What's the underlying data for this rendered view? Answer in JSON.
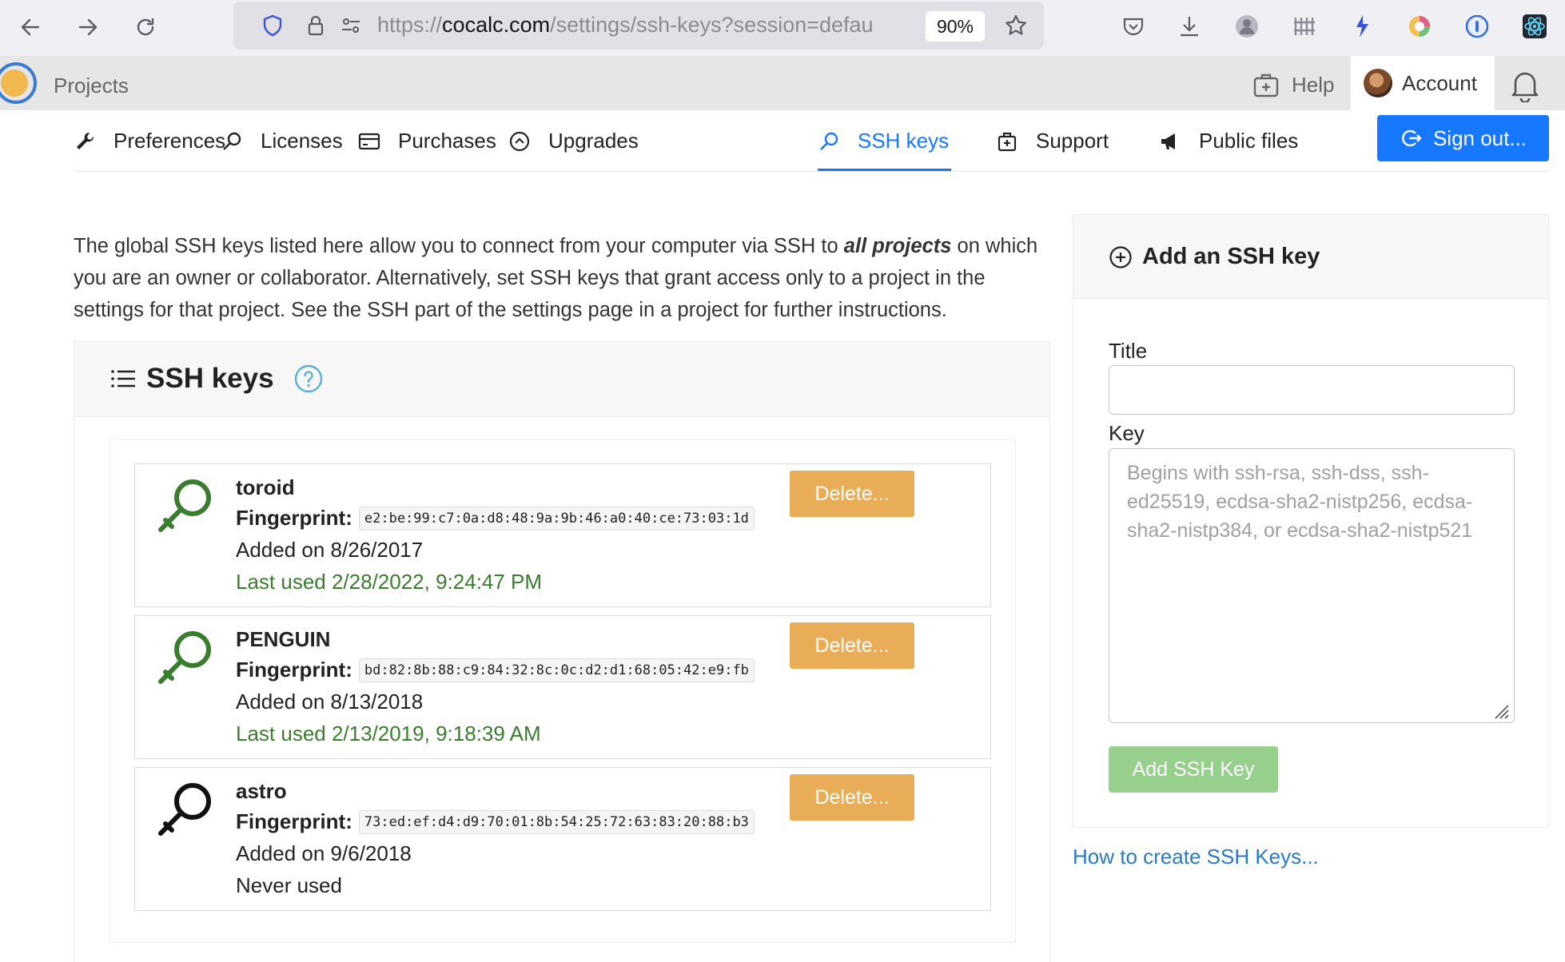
{
  "browser": {
    "url_prefix": "https://",
    "url_host": "cocalc.com",
    "url_path": "/settings/ssh-keys?session=defau",
    "zoom": "90%"
  },
  "appbar": {
    "projects": "Projects",
    "help": "Help",
    "account": "Account"
  },
  "tabs": [
    {
      "label": "Preferences"
    },
    {
      "label": "Licenses"
    },
    {
      "label": "Purchases"
    },
    {
      "label": "Upgrades"
    },
    {
      "label": "SSH keys"
    },
    {
      "label": "Support"
    },
    {
      "label": "Public files"
    }
  ],
  "signout": "Sign out...",
  "intro": {
    "before": "The global SSH keys listed here allow you to connect from your computer via SSH to ",
    "emphasis": "all projects",
    "after": " on which you are an owner or collaborator. Alternatively, set SSH keys that grant access only to a project in the settings for that project. See the SSH part of the settings page in a project for further instructions."
  },
  "keys_panel": {
    "title": "SSH keys",
    "fingerprint_label": "Fingerprint:",
    "delete_label": "Delete...",
    "keys": [
      {
        "name": "toroid",
        "fingerprint": "e2:be:99:c7:0a:d8:48:9a:9b:46:a0:40:ce:73:03:1d",
        "added": "Added on 8/26/2017",
        "last_used": "Last used 2/28/2022, 9:24:47 PM"
      },
      {
        "name": "PENGUIN",
        "fingerprint": "bd:82:8b:88:c9:84:32:8c:0c:d2:d1:68:05:42:e9:fb",
        "added": "Added on 8/13/2018",
        "last_used": "Last used 2/13/2019, 9:18:39 AM"
      },
      {
        "name": "astro",
        "fingerprint": "73:ed:ef:d4:d9:70:01:8b:54:25:72:63:83:20:88:b3",
        "added": "Added on 9/6/2018",
        "last_used": "Never used"
      }
    ]
  },
  "add_panel": {
    "title": "Add an SSH key",
    "title_label": "Title",
    "title_value": "",
    "key_label": "Key",
    "key_placeholder": "Begins with ssh-rsa, ssh-dss, ssh-ed25519, ecdsa-sha2-nistp256, ecdsa-sha2-nistp384, or ecdsa-sha2-nistp521",
    "add_button": "Add SSH Key"
  },
  "howto": "How to create SSH Keys...",
  "colors": {
    "accent": "#1677ff",
    "delete": "#e8ad56",
    "used_green": "#3a7d2e",
    "add_disabled": "#97d08d",
    "link": "#2a7ac0"
  }
}
